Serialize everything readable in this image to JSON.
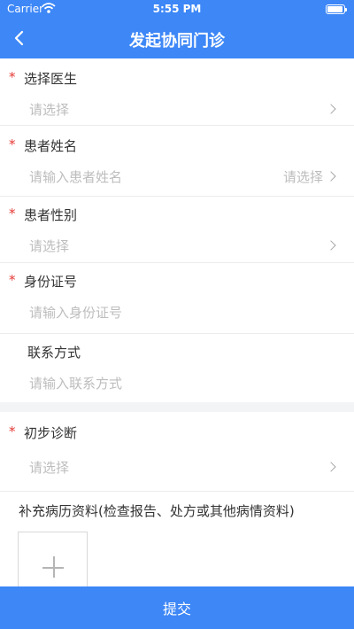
{
  "status_bar": {
    "carrier": "Carrier",
    "time": "5:55 PM"
  },
  "header": {
    "title": "发起协同门诊",
    "back_icon": "chevron-left-icon"
  },
  "fields": {
    "doctor": {
      "required_mark": "*",
      "label": "选择医生",
      "placeholder": "请选择"
    },
    "patient_name": {
      "required_mark": "*",
      "label": "患者姓名",
      "placeholder": "请输入患者姓名",
      "select_label": "请选择"
    },
    "patient_gender": {
      "required_mark": "*",
      "label": "患者性别",
      "placeholder": "请选择"
    },
    "id_number": {
      "required_mark": "*",
      "label": "身份证号",
      "placeholder": "请输入身份证号"
    },
    "contact": {
      "label": "联系方式",
      "placeholder": "请输入联系方式"
    },
    "diagnosis": {
      "required_mark": "*",
      "label": "初步诊断",
      "placeholder": "请选择"
    }
  },
  "supplement": {
    "label": "补充病历资料(检查报告、处方或其他病情资料)",
    "upload_icon": "plus-icon"
  },
  "submit_label": "提交",
  "colors": {
    "primary": "#3d87f7",
    "required": "#e53935",
    "placeholder": "#bdbdbd"
  }
}
